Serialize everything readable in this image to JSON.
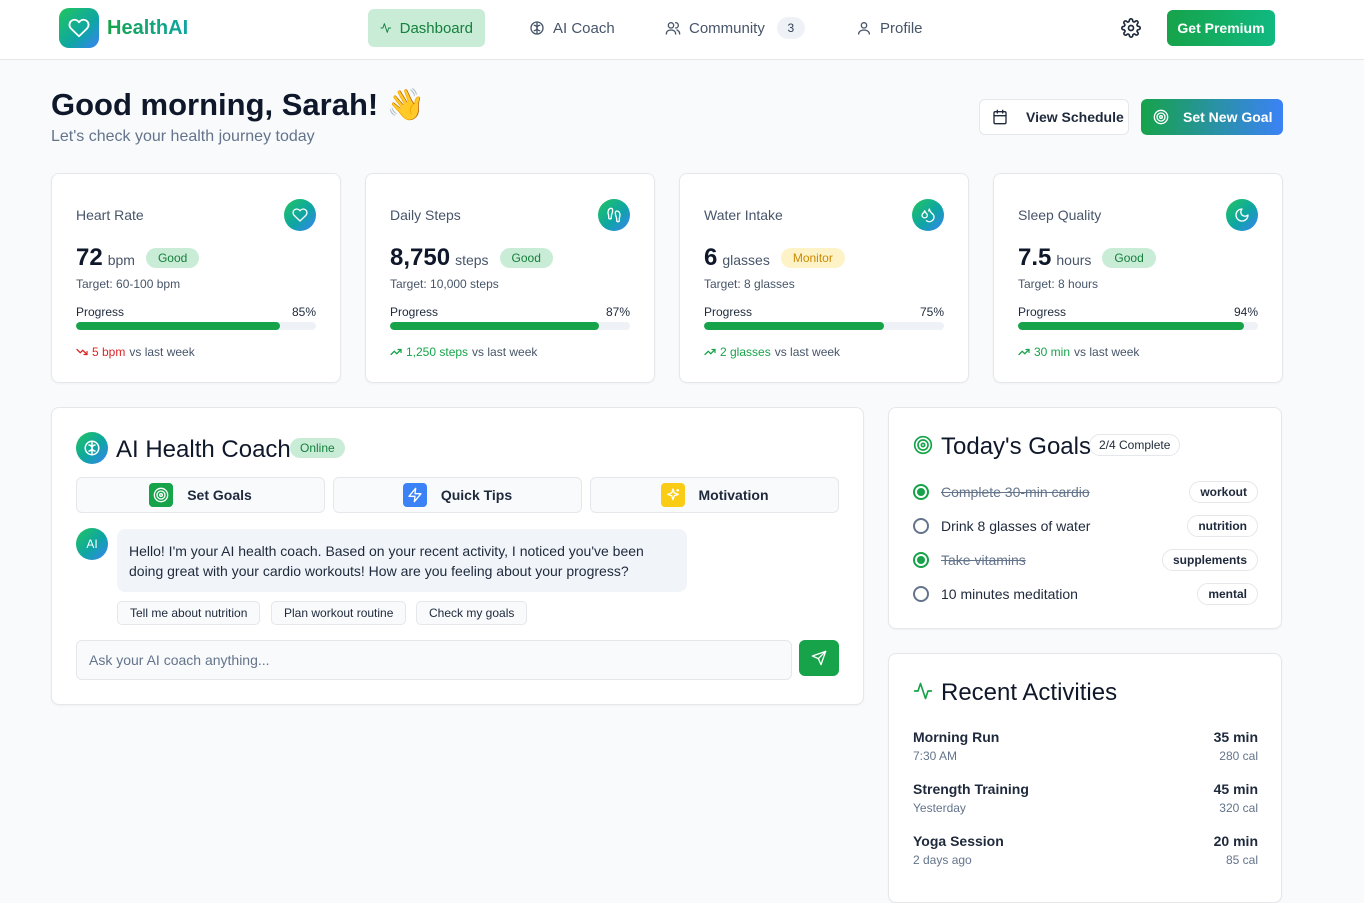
{
  "app": {
    "name": "HealthAI"
  },
  "nav": {
    "items": [
      {
        "label": "Dashboard",
        "icon": "activity-icon"
      },
      {
        "label": "AI Coach",
        "icon": "brain-icon"
      },
      {
        "label": "Community",
        "icon": "users-icon",
        "badge": "3"
      },
      {
        "label": "Profile",
        "icon": "user-icon"
      }
    ],
    "premium_label": "Get Premium"
  },
  "header": {
    "greeting": "Good morning, Sarah! 👋",
    "subtitle": "Let's check your health journey today",
    "schedule_label": "View Schedule",
    "goal_label": "Set New Goal"
  },
  "stats": [
    {
      "title": "Heart Rate",
      "value": "72",
      "unit": "bpm",
      "status": "Good",
      "target": "Target: 60-100 bpm",
      "progress_label": "Progress",
      "progress": "85%",
      "trend_value": "5 bpm",
      "trend_text": "vs last week",
      "trend_dir": "down",
      "icon": "heart-icon"
    },
    {
      "title": "Daily Steps",
      "value": "8,750",
      "unit": "steps",
      "status": "Good",
      "target": "Target: 10,000 steps",
      "progress_label": "Progress",
      "progress": "87%",
      "trend_value": "1,250 steps",
      "trend_text": "vs last week",
      "trend_dir": "up",
      "icon": "footprints-icon"
    },
    {
      "title": "Water Intake",
      "value": "6",
      "unit": "glasses",
      "status": "Monitor",
      "target": "Target: 8 glasses",
      "progress_label": "Progress",
      "progress": "75%",
      "trend_value": "2 glasses",
      "trend_text": "vs last week",
      "trend_dir": "up",
      "icon": "droplets-icon"
    },
    {
      "title": "Sleep Quality",
      "value": "7.5",
      "unit": "hours",
      "status": "Good",
      "target": "Target: 8 hours",
      "progress_label": "Progress",
      "progress": "94%",
      "trend_value": "30 min",
      "trend_text": "vs last week",
      "trend_dir": "up",
      "icon": "moon-icon"
    }
  ],
  "coach": {
    "title": "AI Health Coach",
    "status": "Online",
    "quick": [
      {
        "label": "Set Goals",
        "icon": "target-icon",
        "color": "#16a34a"
      },
      {
        "label": "Quick Tips",
        "icon": "zap-icon",
        "color": "#3b82f6"
      },
      {
        "label": "Motivation",
        "icon": "sparkles-icon",
        "color": "#facc15"
      }
    ],
    "avatar": "AI",
    "message": "Hello! I'm your AI health coach. Based on your recent activity, I noticed you've been doing great with your cardio workouts! How are you feeling about your progress?",
    "suggestions": [
      "Tell me about nutrition",
      "Plan workout routine",
      "Check my goals"
    ],
    "input_placeholder": "Ask your AI coach anything..."
  },
  "goals": {
    "title": "Today's Goals",
    "count": "2/4 Complete",
    "items": [
      {
        "text": "Complete 30-min cardio",
        "tag": "workout",
        "done": true
      },
      {
        "text": "Drink 8 glasses of water",
        "tag": "nutrition",
        "done": false
      },
      {
        "text": "Take vitamins",
        "tag": "supplements",
        "done": true
      },
      {
        "text": "10 minutes meditation",
        "tag": "mental",
        "done": false
      }
    ]
  },
  "activities": {
    "title": "Recent Activities",
    "items": [
      {
        "name": "Morning Run",
        "when": "7:30 AM",
        "duration": "35 min",
        "calories": "280 cal"
      },
      {
        "name": "Strength Training",
        "when": "Yesterday",
        "duration": "45 min",
        "calories": "320 cal"
      },
      {
        "name": "Yoga Session",
        "when": "2 days ago",
        "duration": "20 min",
        "calories": "85 cal"
      }
    ]
  },
  "colors": {
    "brand": "#16a34a",
    "accent": "#3b82f6",
    "teal": "#0ea5a4",
    "warning": "#ca8a04",
    "danger": "#dc2626"
  }
}
